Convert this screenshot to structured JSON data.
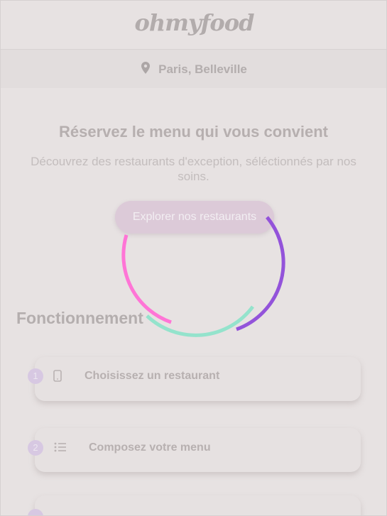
{
  "header": {
    "logo": "ohmyfood"
  },
  "location": {
    "icon": "map-pin-icon",
    "text": "Paris, Belleville"
  },
  "hero": {
    "title": "Réservez le menu qui vous convient",
    "subtitle": "Découvrez des restaurants d'exception, séléctionnés par nos soins.",
    "cta_label": "Explorer nos restaurants"
  },
  "loader": {
    "colors": [
      "#ff6fcf",
      "#93e8cc",
      "#9b4fdc"
    ]
  },
  "how_it_works": {
    "title": "Fonctionnement",
    "steps": [
      {
        "number": "1",
        "icon": "phone-icon",
        "label": "Choisissez un restaurant"
      },
      {
        "number": "2",
        "icon": "list-icon",
        "label": "Composez votre menu"
      },
      {
        "number": "3",
        "icon": "",
        "label": ""
      }
    ]
  },
  "colors": {
    "accent_purple": "#9356dc",
    "accent_pink": "#ff79da"
  }
}
